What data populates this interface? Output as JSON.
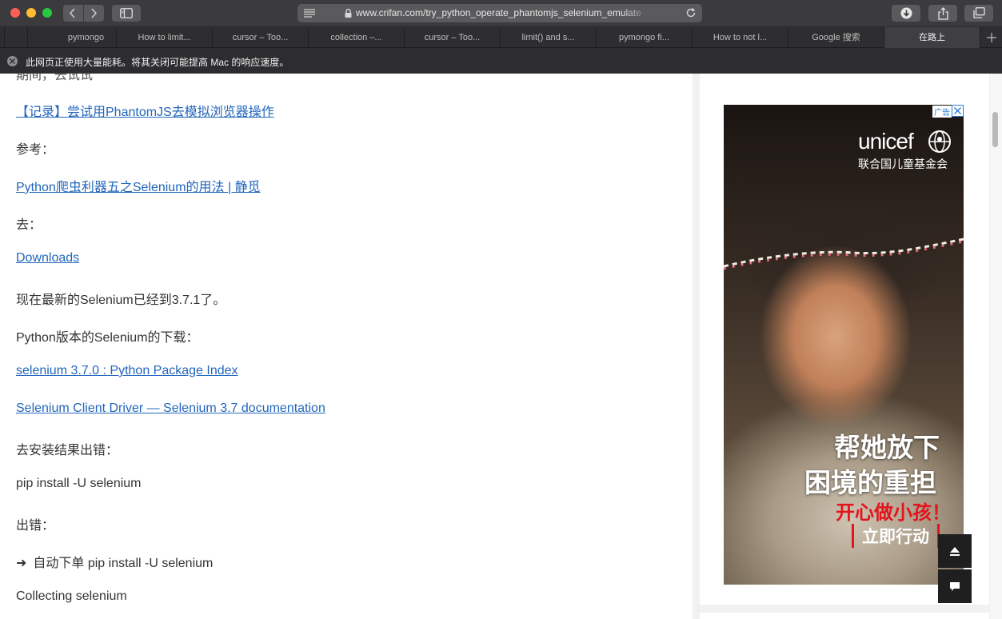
{
  "browser": {
    "url": "www.crifan.com/try_python_operate_phantomjs_selenium_emulate",
    "tabs": [
      {
        "label": ""
      },
      {
        "label": "pymongo"
      },
      {
        "label": "How to limit..."
      },
      {
        "label": "cursor – Too..."
      },
      {
        "label": "collection –..."
      },
      {
        "label": "cursor – Too..."
      },
      {
        "label": "limit() and s..."
      },
      {
        "label": "pymongo fi..."
      },
      {
        "label": "How to not l..."
      },
      {
        "label": "Google 搜索"
      },
      {
        "label": "在路上",
        "active": true
      }
    ],
    "notice": "此网页正使用大量能耗。将其关闭可能提高 Mac 的响应速度。"
  },
  "article": {
    "partial_top": "期间，去试试",
    "lines": [
      {
        "text": "【记录】尝试用PhantomJS去模拟浏览器操作",
        "link": true
      },
      {
        "text": "参考：",
        "link": false
      },
      {
        "text": "Python爬虫利器五之Selenium的用法 | 静觅",
        "link": true
      },
      {
        "text": "去：",
        "link": false
      },
      {
        "text": "Downloads",
        "link": true
      },
      {
        "text": "现在最新的Selenium已经到3.7.1了。",
        "link": false
      },
      {
        "text": "Python版本的Selenium的下载：",
        "link": false
      },
      {
        "text": "selenium 3.7.0 : Python Package Index",
        "link": true
      },
      {
        "text": "Selenium Client Driver — Selenium 3.7 documentation",
        "link": true
      },
      {
        "text": "去安装结果出错：",
        "link": false
      },
      {
        "text": "pip install -U selenium",
        "link": false
      },
      {
        "text": "出错：",
        "link": false
      },
      {
        "text": "自动下单 pip install -U selenium",
        "link": false,
        "arrow": "➜"
      },
      {
        "text": "Collecting selenium",
        "link": false
      }
    ]
  },
  "ad": {
    "label": "广告",
    "brand": "unicef",
    "brand_sub": "联合国儿童基金会",
    "headline1": "帮她放下",
    "headline2": "困境的重担",
    "headline3": "开心做小孩！",
    "cta": "立即行动"
  },
  "colors": {
    "link": "#2266bb",
    "ad_red": "#e3141c",
    "chrome_dark": "#3b3a3d"
  }
}
